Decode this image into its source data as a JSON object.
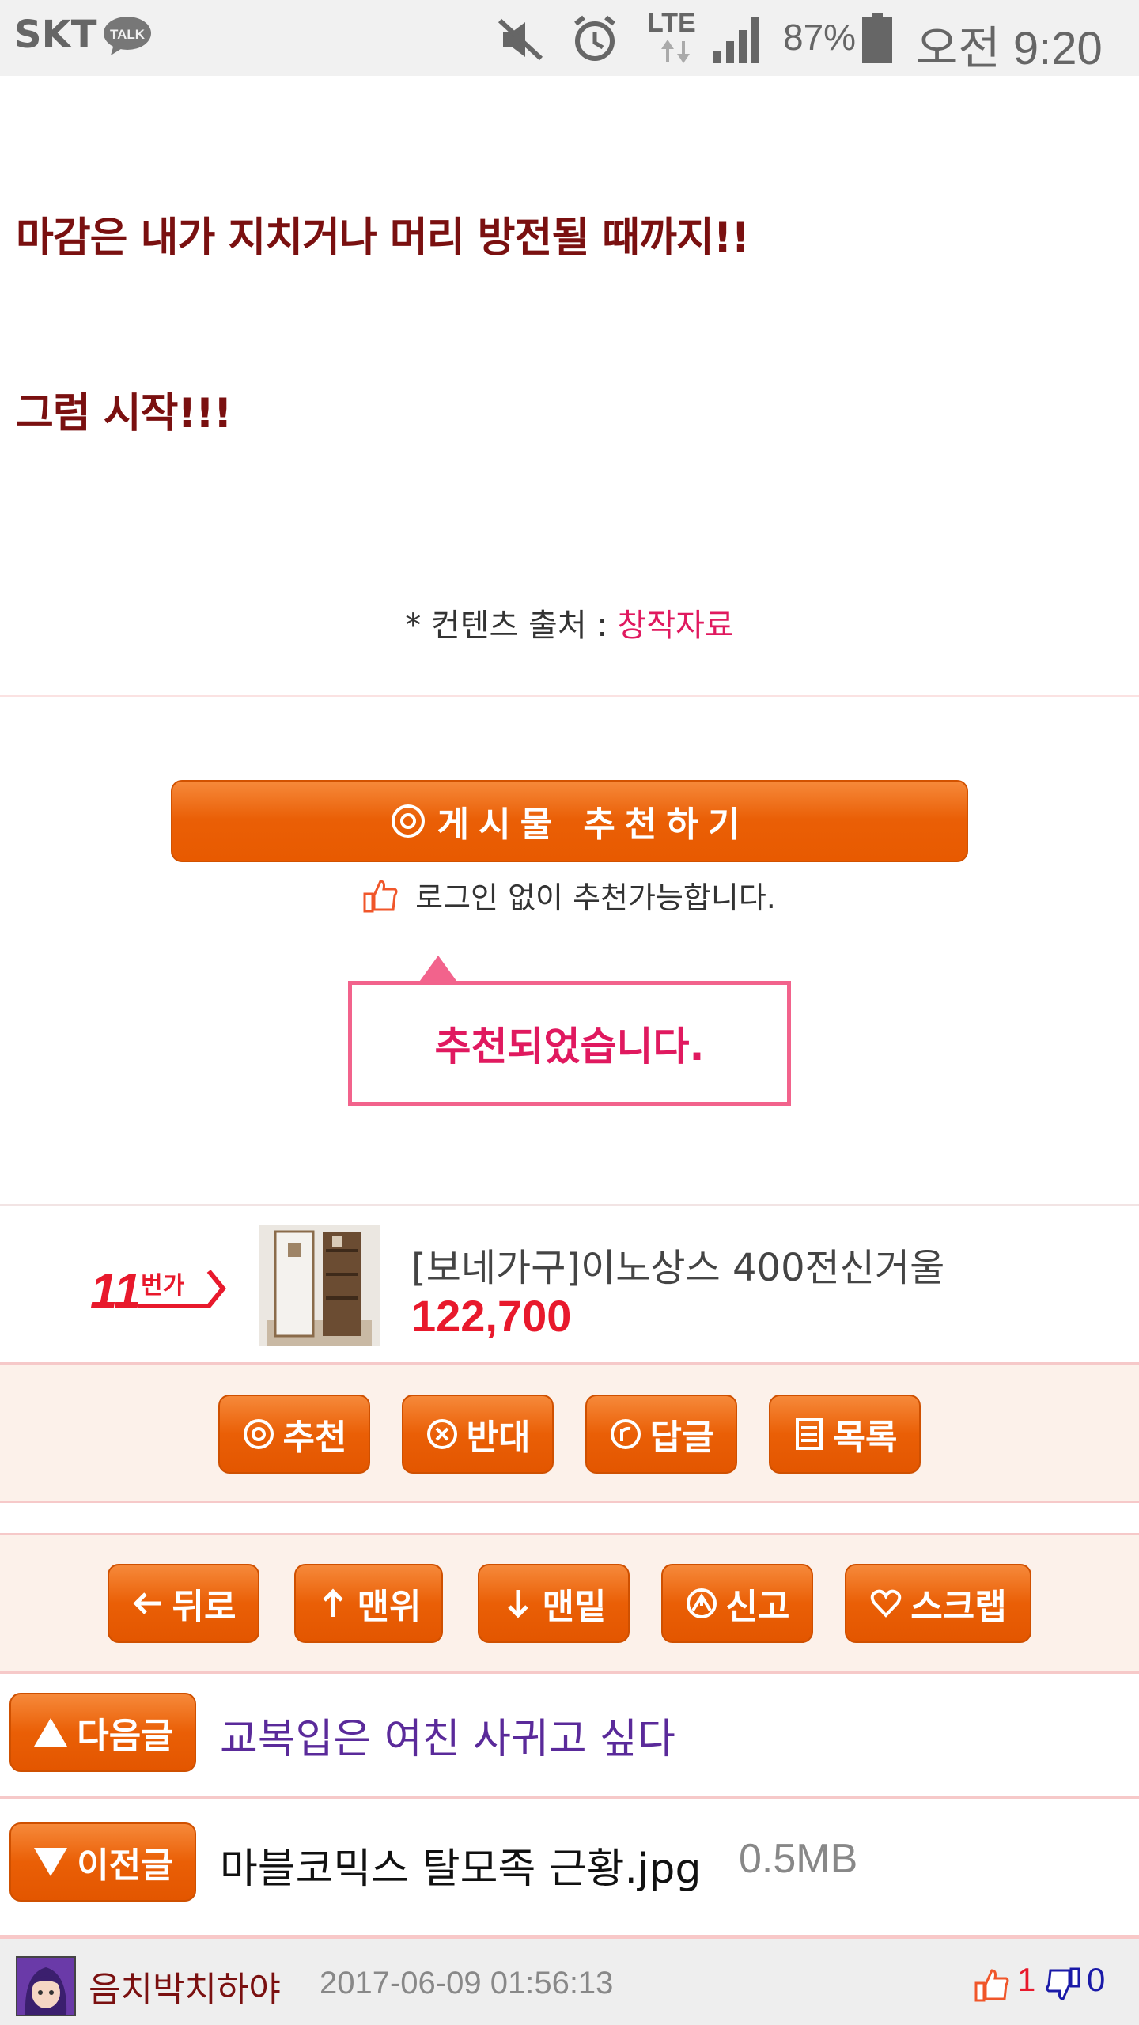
{
  "status_bar": {
    "carrier": "SKT",
    "talk_badge": "TALK",
    "network": "LTE",
    "battery": "87%",
    "time": "오전 9:20"
  },
  "article": {
    "line1": "마감은 내가 지치거나 머리 방전될 때까지!!",
    "line2": "그럼 시작!!!",
    "source_prefix": "* 컨텐츠 출처 : ",
    "source_link": "창작자료"
  },
  "recommend": {
    "big_button": "게시물 추천하기",
    "note": "로그인 없이 추천가능합니다.",
    "callout": "추천되었습니다."
  },
  "ad": {
    "logo": "11번가",
    "title": "[보네가구]이노상스 400전신거울",
    "price": "122,700"
  },
  "actions_row1": [
    {
      "label": "추천",
      "icon": "circle-o-icon"
    },
    {
      "label": "반대",
      "icon": "circle-x-icon"
    },
    {
      "label": "답글",
      "icon": "circle-r-icon"
    },
    {
      "label": "목록",
      "icon": "list-icon"
    }
  ],
  "actions_row2": [
    {
      "label": "뒤로",
      "icon": "arrow-left-icon"
    },
    {
      "label": "맨위",
      "icon": "arrow-up-icon"
    },
    {
      "label": "맨밑",
      "icon": "arrow-down-icon"
    },
    {
      "label": "신고",
      "icon": "report-icon"
    },
    {
      "label": "스크랩",
      "icon": "heart-icon"
    }
  ],
  "next_post": {
    "label": "다음글",
    "title": "교복입은 여친 사귀고 싶다"
  },
  "prev_post": {
    "label": "이전글",
    "title": "마블코믹스 탈모족 근황.jpg",
    "size": "0.5MB"
  },
  "footer": {
    "author": "음치박치하야",
    "date": "2017-06-09 01:56:13",
    "upvotes": "1",
    "downvotes": "0"
  },
  "colors": {
    "accent_orange": "#ea5f06",
    "heading_red": "#7a1010",
    "link_pink": "#e0195f",
    "next_title": "#5a2a9a"
  }
}
